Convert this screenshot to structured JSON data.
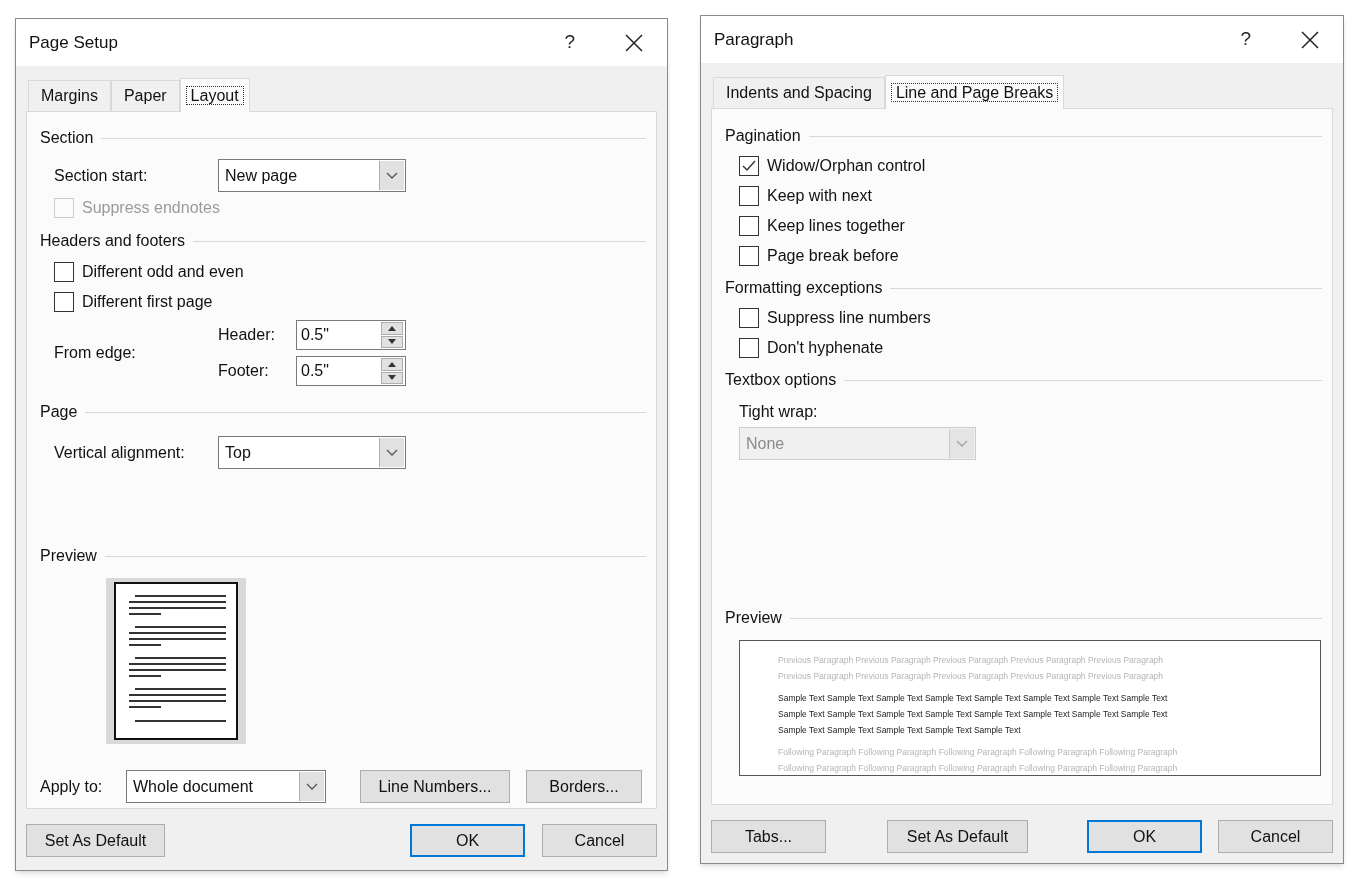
{
  "page_setup": {
    "title": "Page Setup",
    "help": "?",
    "tabs": [
      {
        "label": "Margins",
        "selected": false
      },
      {
        "label": "Paper",
        "selected": false
      },
      {
        "label": "Layout",
        "selected": true
      }
    ],
    "section": {
      "heading": "Section",
      "section_start": {
        "label": "Section start:",
        "value": "New page"
      },
      "suppress_endnotes": {
        "label": "Suppress endnotes",
        "checked": false,
        "disabled": true
      }
    },
    "headers_footers": {
      "heading": "Headers and footers",
      "options": [
        {
          "label": "Different odd and even",
          "checked": false,
          "disabled": false
        },
        {
          "label": "Different first page",
          "checked": false,
          "disabled": false
        }
      ],
      "from_edge": {
        "label": "From edge:",
        "fields": [
          {
            "label": "Header:",
            "value": "0.5\""
          },
          {
            "label": "Footer:",
            "value": "0.5\""
          }
        ]
      }
    },
    "page": {
      "heading": "Page",
      "vertical_alignment": {
        "label": "Vertical alignment:",
        "value": "Top"
      }
    },
    "preview": {
      "heading": "Preview"
    },
    "apply_to": {
      "label": "Apply to:",
      "value": "Whole document"
    },
    "panel_buttons": [
      {
        "label": "Line Numbers..."
      },
      {
        "label": "Borders..."
      }
    ],
    "footer_buttons": [
      {
        "label": "Set As Default",
        "default": false
      },
      {
        "label": "OK",
        "default": true
      },
      {
        "label": "Cancel",
        "default": false
      }
    ]
  },
  "paragraph": {
    "title": "Paragraph",
    "help": "?",
    "tabs": [
      {
        "label": "Indents and Spacing",
        "selected": false
      },
      {
        "label": "Line and Page Breaks",
        "selected": true
      }
    ],
    "pagination": {
      "heading": "Pagination",
      "options": [
        {
          "label": "Widow/Orphan control",
          "checked": true,
          "disabled": false
        },
        {
          "label": "Keep with next",
          "checked": false,
          "disabled": false
        },
        {
          "label": "Keep lines together",
          "checked": false,
          "disabled": false
        },
        {
          "label": "Page break before",
          "checked": false,
          "disabled": false
        }
      ]
    },
    "formatting_exceptions": {
      "heading": "Formatting exceptions",
      "options": [
        {
          "label": "Suppress line numbers",
          "checked": false,
          "disabled": false
        },
        {
          "label": "Don't hyphenate",
          "checked": false,
          "disabled": false
        }
      ]
    },
    "textbox_options": {
      "heading": "Textbox options",
      "tight_wrap": {
        "label": "Tight wrap:",
        "value": "None",
        "disabled": true
      }
    },
    "preview": {
      "heading": "Preview",
      "paragraphs": [
        {
          "kind": "previous",
          "lines": [
            "Previous Paragraph Previous Paragraph Previous Paragraph Previous Paragraph Previous Paragraph",
            "Previous Paragraph Previous Paragraph Previous Paragraph Previous Paragraph Previous Paragraph"
          ]
        },
        {
          "kind": "sample",
          "lines": [
            "Sample Text Sample Text Sample Text Sample Text Sample Text Sample Text Sample Text Sample Text",
            "Sample Text Sample Text Sample Text Sample Text Sample Text Sample Text Sample Text Sample Text",
            "Sample Text Sample Text Sample Text Sample Text Sample Text"
          ]
        },
        {
          "kind": "following",
          "lines": [
            "Following Paragraph Following Paragraph Following Paragraph Following Paragraph Following Paragraph",
            "Following Paragraph Following Paragraph Following Paragraph Following Paragraph Following Paragraph"
          ]
        }
      ]
    },
    "footer_buttons": [
      {
        "label": "Tabs...",
        "default": false
      },
      {
        "label": "Set As Default",
        "default": false
      },
      {
        "label": "OK",
        "default": true
      },
      {
        "label": "Cancel",
        "default": false
      }
    ]
  }
}
